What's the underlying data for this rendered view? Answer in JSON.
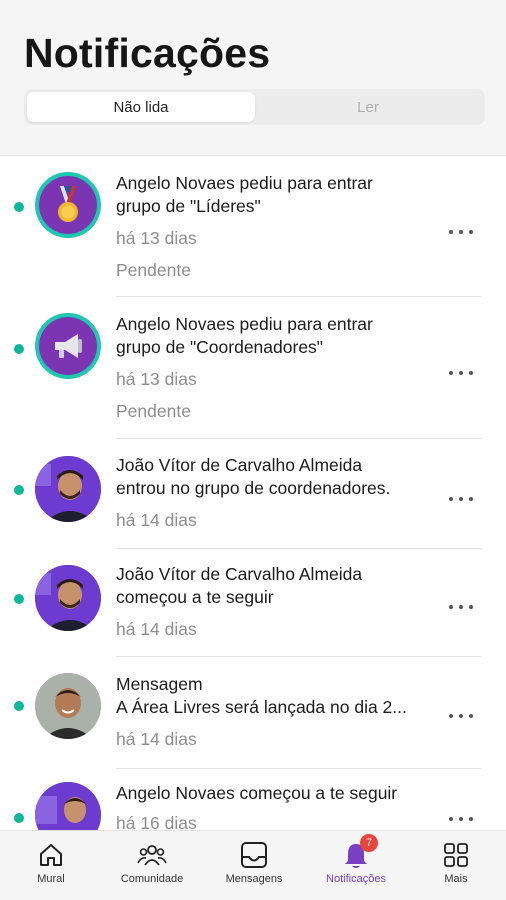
{
  "header": {
    "title": "Notificações",
    "tabs": [
      {
        "label": "Não lida",
        "active": true
      },
      {
        "label": "Ler",
        "active": false
      }
    ]
  },
  "notifications": [
    {
      "title_line1": "Angelo Novaes pediu para entrar",
      "title_line2": "grupo de \"Líderes\"",
      "time": "há 13 dias",
      "status": "Pendente",
      "avatar": "medal-icon",
      "unread": true
    },
    {
      "title_line1": "Angelo Novaes pediu para entrar",
      "title_line2": "grupo de \"Coordenadores\"",
      "time": "há 13 dias",
      "status": "Pendente",
      "avatar": "megaphone-icon",
      "unread": true
    },
    {
      "title_line1": "João Vítor de Carvalho Almeida",
      "title_line2": "entrou no grupo de coordenadores.",
      "time": "há 14 dias",
      "avatar": "user-photo-avatar",
      "unread": true
    },
    {
      "title_line1": "João Vítor de Carvalho Almeida",
      "title_line2": "começou a te seguir",
      "time": "há 14 dias",
      "avatar": "user-photo-avatar",
      "unread": true
    },
    {
      "title_line1": "Mensagem",
      "title_line2": "A Área Livres será lançada no dia 2...",
      "time": "há 14 dias",
      "avatar": "user-photo-avatar",
      "unread": true
    },
    {
      "title_line1": "Angelo Novaes começou a te seguir",
      "title_line2": "",
      "time": "há 16 dias",
      "avatar": "user-photo-avatar",
      "unread": true
    }
  ],
  "tabbar": {
    "items": [
      {
        "label": "Mural",
        "icon": "home-icon"
      },
      {
        "label": "Comunidade",
        "icon": "community-icon"
      },
      {
        "label": "Mensagens",
        "icon": "inbox-icon"
      },
      {
        "label": "Notificações",
        "icon": "bell-icon",
        "active": true,
        "badge": "7"
      },
      {
        "label": "Mais",
        "icon": "grid-icon"
      }
    ]
  },
  "colors": {
    "accent": "#7a3fc2",
    "unread_dot": "#11b59c",
    "badge": "#e8453c",
    "avatar_ring": "#1ec7b0"
  }
}
